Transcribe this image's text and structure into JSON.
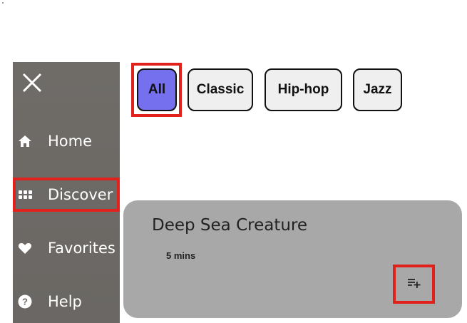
{
  "sidebar": {
    "close_icon": "close-icon",
    "items": [
      {
        "label": "Home",
        "icon": "home-icon"
      },
      {
        "label": "Discover",
        "icon": "grid-icon",
        "active": true
      },
      {
        "label": "Favorites",
        "icon": "heart-icon"
      },
      {
        "label": "Help",
        "icon": "help-icon"
      }
    ]
  },
  "filters": {
    "chips": [
      {
        "label": "All",
        "selected": true
      },
      {
        "label": "Classic"
      },
      {
        "label": "Hip-hop"
      },
      {
        "label": "Jazz"
      }
    ]
  },
  "card": {
    "title": "Deep Sea Creature",
    "duration": "5 mins",
    "add_icon": "playlist-add-icon"
  },
  "colors": {
    "sidebar_bg": "#6f6c68",
    "chip_selected": "#7470ee",
    "chip_bg": "#efefef",
    "card_bg": "#a8a8a8",
    "focus_outline": "#e0211c"
  }
}
